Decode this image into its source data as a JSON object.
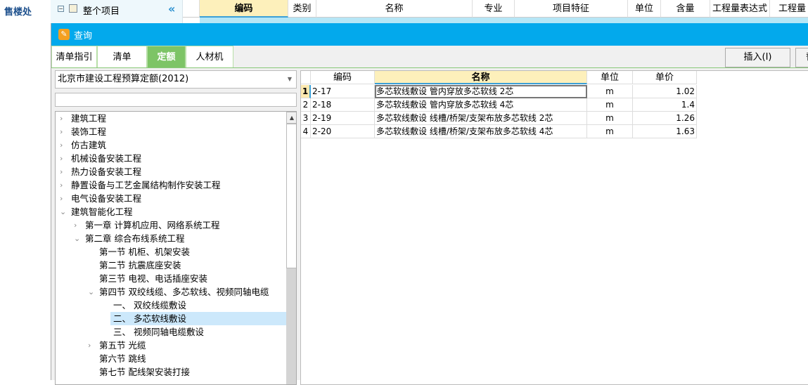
{
  "sidebar": {
    "title": "售楼处"
  },
  "project": {
    "root_label": "整个项目"
  },
  "background_table": {
    "headers": [
      "编码",
      "类别",
      "名称",
      "专业",
      "项目特征",
      "单位",
      "含量",
      "工程量表达式",
      "工程量"
    ]
  },
  "dialog": {
    "title": "查询",
    "tabs": [
      {
        "label": "清单指引"
      },
      {
        "label": "清单"
      },
      {
        "label": "定额"
      },
      {
        "label": "人材机"
      }
    ],
    "active_tab": "定额",
    "buttons": {
      "insert": "插入(I)",
      "replace": "替"
    },
    "library": "北京市建设工程预算定额(2012)",
    "search": "",
    "tree": [
      {
        "label": "建筑工程",
        "level": 0,
        "expander": "›"
      },
      {
        "label": "装饰工程",
        "level": 0,
        "expander": "›"
      },
      {
        "label": "仿古建筑",
        "level": 0,
        "expander": "›"
      },
      {
        "label": "机械设备安装工程",
        "level": 0,
        "expander": "›"
      },
      {
        "label": "热力设备安装工程",
        "level": 0,
        "expander": "›"
      },
      {
        "label": "静置设备与工艺金属结构制作安装工程",
        "level": 0,
        "expander": "›"
      },
      {
        "label": "电气设备安装工程",
        "level": 0,
        "expander": "›"
      },
      {
        "label": "建筑智能化工程",
        "level": 0,
        "expander": "⌄"
      },
      {
        "label": "第一章 计算机应用、网络系统工程",
        "level": 1,
        "expander": "›"
      },
      {
        "label": "第二章 综合布线系统工程",
        "level": 1,
        "expander": "⌄"
      },
      {
        "label": "第一节 机柜、机架安装",
        "level": 2,
        "expander": ""
      },
      {
        "label": "第二节 抗震底座安装",
        "level": 2,
        "expander": ""
      },
      {
        "label": "第三节 电视、电话插座安装",
        "level": 2,
        "expander": ""
      },
      {
        "label": "第四节 双绞线缆、多芯软线、视频同轴电缆",
        "level": 2,
        "expander": "⌄"
      },
      {
        "label": "一、  双绞线缆敷设",
        "level": 3,
        "expander": ""
      },
      {
        "label": "二、  多芯软线敷设",
        "level": 3,
        "expander": "",
        "selected": true
      },
      {
        "label": "三、  视频同轴电缆敷设",
        "level": 3,
        "expander": ""
      },
      {
        "label": "第五节 光缆",
        "level": 2,
        "expander": "›"
      },
      {
        "label": "第六节 跳线",
        "level": 2,
        "expander": ""
      },
      {
        "label": "第七节 配线架安装打接",
        "level": 2,
        "expander": ""
      }
    ],
    "grid": {
      "headers": [
        "编码",
        "名称",
        "单位",
        "单价"
      ],
      "rows": [
        {
          "no": "1",
          "code": "2-17",
          "name": "多芯软线敷设 管内穿放多芯软线 2芯",
          "unit": "m",
          "price": "1.02"
        },
        {
          "no": "2",
          "code": "2-18",
          "name": "多芯软线敷设 管内穿放多芯软线 4芯",
          "unit": "m",
          "price": "1.4"
        },
        {
          "no": "3",
          "code": "2-19",
          "name": "多芯软线敷设 线槽/桥架/支架布放多芯软线 2芯",
          "unit": "m",
          "price": "1.26"
        },
        {
          "no": "4",
          "code": "2-20",
          "name": "多芯软线敷设 线槽/桥架/支架布放多芯软线 4芯",
          "unit": "m",
          "price": "1.63"
        }
      ]
    }
  },
  "colors": {
    "title_bar": "#03a9ec",
    "active_tab": "#7dc466",
    "selected_header": "#fdf0bb",
    "tree_selected": "#cce8fb"
  }
}
